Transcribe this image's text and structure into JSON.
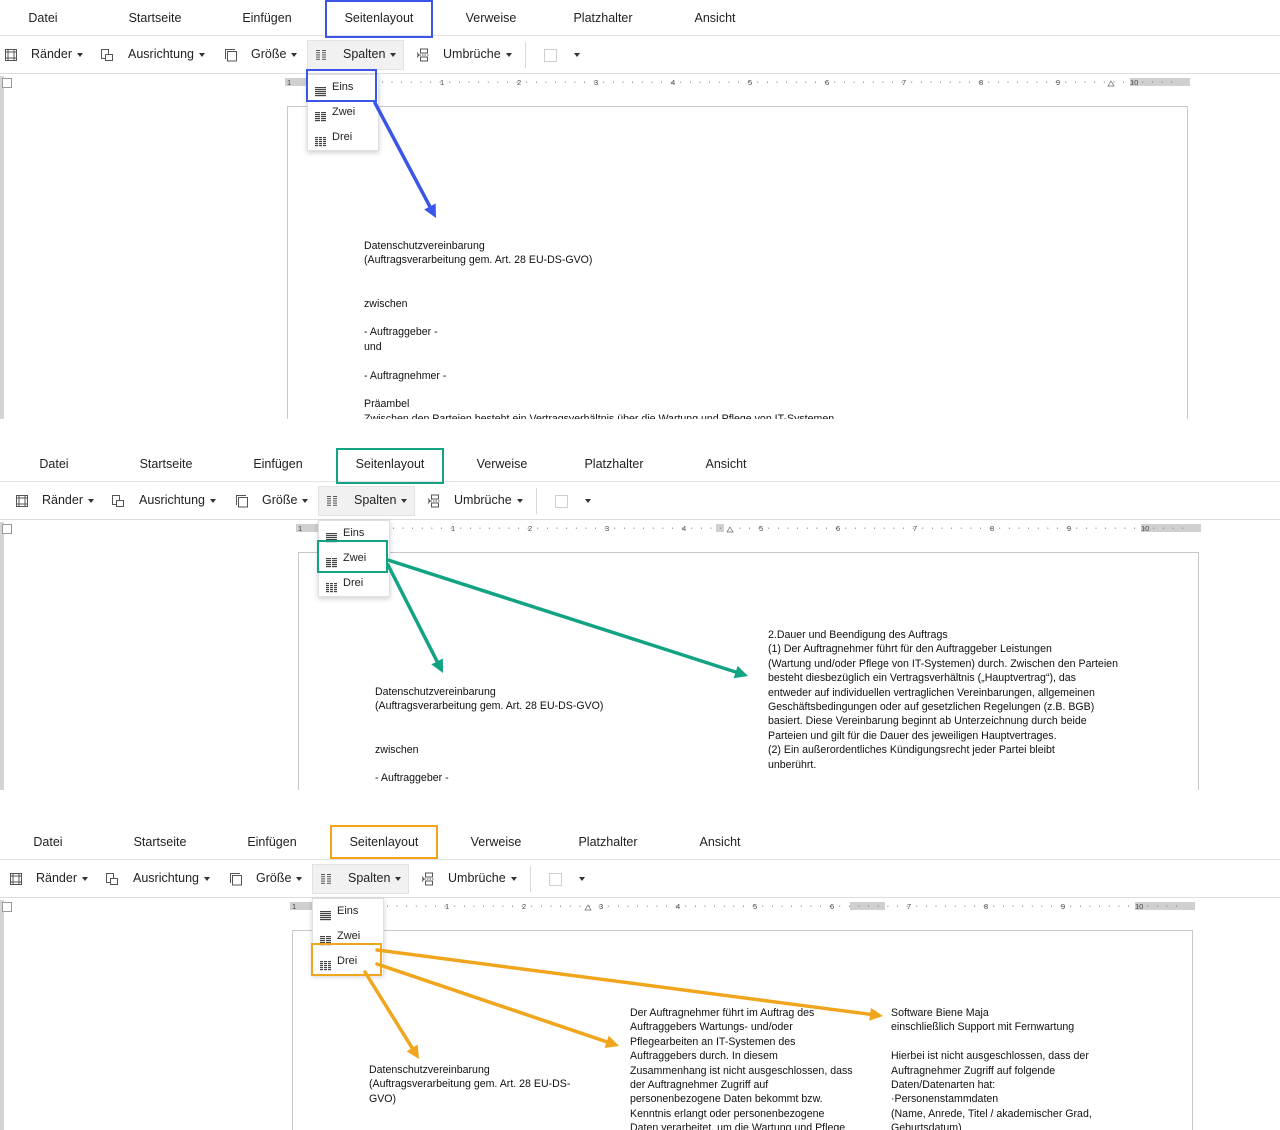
{
  "colors": {
    "blue": "#3a55e8",
    "teal": "#12a383",
    "orange": "#f0a51c"
  },
  "tabs": [
    "Datei",
    "Startseite",
    "Einfügen",
    "Seitenlayout",
    "Verweise",
    "Platzhalter",
    "Ansicht"
  ],
  "toolbar": {
    "raender": "Ränder",
    "ausrichtung": "Ausrichtung",
    "groesse": "Größe",
    "spalten": "Spalten",
    "umbrueche": "Umbrüche"
  },
  "icons": [
    "margins-icon",
    "orientation-icon",
    "size-icon",
    "columns-icon",
    "breaks-icon",
    "border-box-icon"
  ],
  "dropdown": [
    "Eins",
    "Zwei",
    "Drei"
  ],
  "ruler_labels": [
    "1",
    "1",
    "2",
    "3",
    "4",
    "5",
    "6",
    "7",
    "8",
    "9",
    "10"
  ],
  "panels": [
    {
      "highlight": "Eins",
      "doc_lines": [
        "Datenschutzvereinbarung",
        "(Auftragsverarbeitung gem. Art. 28 EU-DS-GVO)",
        "",
        "",
        "zwischen",
        "",
        "- Auftraggeber -",
        "und",
        "",
        "- Auftragnehmer -",
        "",
        "Präambel",
        "Zwischen den Parteien besteht ein Vertragsverhältnis über die Wartung und Pflege von IT-Systemen"
      ]
    },
    {
      "highlight": "Zwei",
      "col1_lines": [
        "Datenschutzvereinbarung",
        "(Auftragsverarbeitung gem. Art. 28 EU-DS-GVO)",
        "",
        "",
        "zwischen",
        "",
        "- Auftraggeber -"
      ],
      "col2_lines": [
        "2.Dauer und Beendigung des Auftrags",
        "(1)        Der Auftragnehmer führt für den Auftraggeber Leistungen",
        "(Wartung und/oder Pflege von IT-Systemen) durch. Zwischen den Parteien",
        "besteht diesbezüglich ein Vertragsverhältnis („Hauptvertrag“), das",
        "entweder auf individuellen vertraglichen Vereinbarungen, allgemeinen",
        "Geschäftsbedingungen oder auf gesetzlichen Regelungen (z.B. BGB)",
        "basiert. Diese Vereinbarung beginnt ab Unterzeichnung durch beide",
        "Parteien und gilt für die Dauer des jeweiligen Hauptvertrages.",
        "(2)        Ein außerordentliches Kündigungsrecht jeder Partei bleibt",
        "unberührt."
      ]
    },
    {
      "highlight": "Drei",
      "col1_lines": [
        "Datenschutzvereinbarung",
        "(Auftragsverarbeitung gem. Art. 28 EU-DS-",
        "GVO)"
      ],
      "col2_lines": [
        "Der Auftragnehmer führt im Auftrag des",
        "Auftraggebers Wartungs- und/oder",
        "Pflegearbeiten an IT-Systemen des",
        "Auftraggebers durch. In diesem",
        "Zusammenhang ist nicht ausgeschlossen, dass",
        "der Auftragnehmer Zugriff auf",
        "personenbezogene Daten bekommt bzw.",
        "Kenntnis erlangt oder personenbezogene",
        "Daten verarbeitet, um die Wartung und Pflege"
      ],
      "col3_lines": [
        "Software Biene Maja",
        "einschließlich Support mit Fernwartung",
        "",
        "Hierbei ist nicht ausgeschlossen, dass der",
        "Auftragnehmer Zugriff auf folgende",
        "Daten/Datenarten hat:",
        "·Personenstammdaten",
        "(Name, Anrede, Titel / akademischer Grad,",
        "Geburtsdatum)"
      ]
    }
  ]
}
